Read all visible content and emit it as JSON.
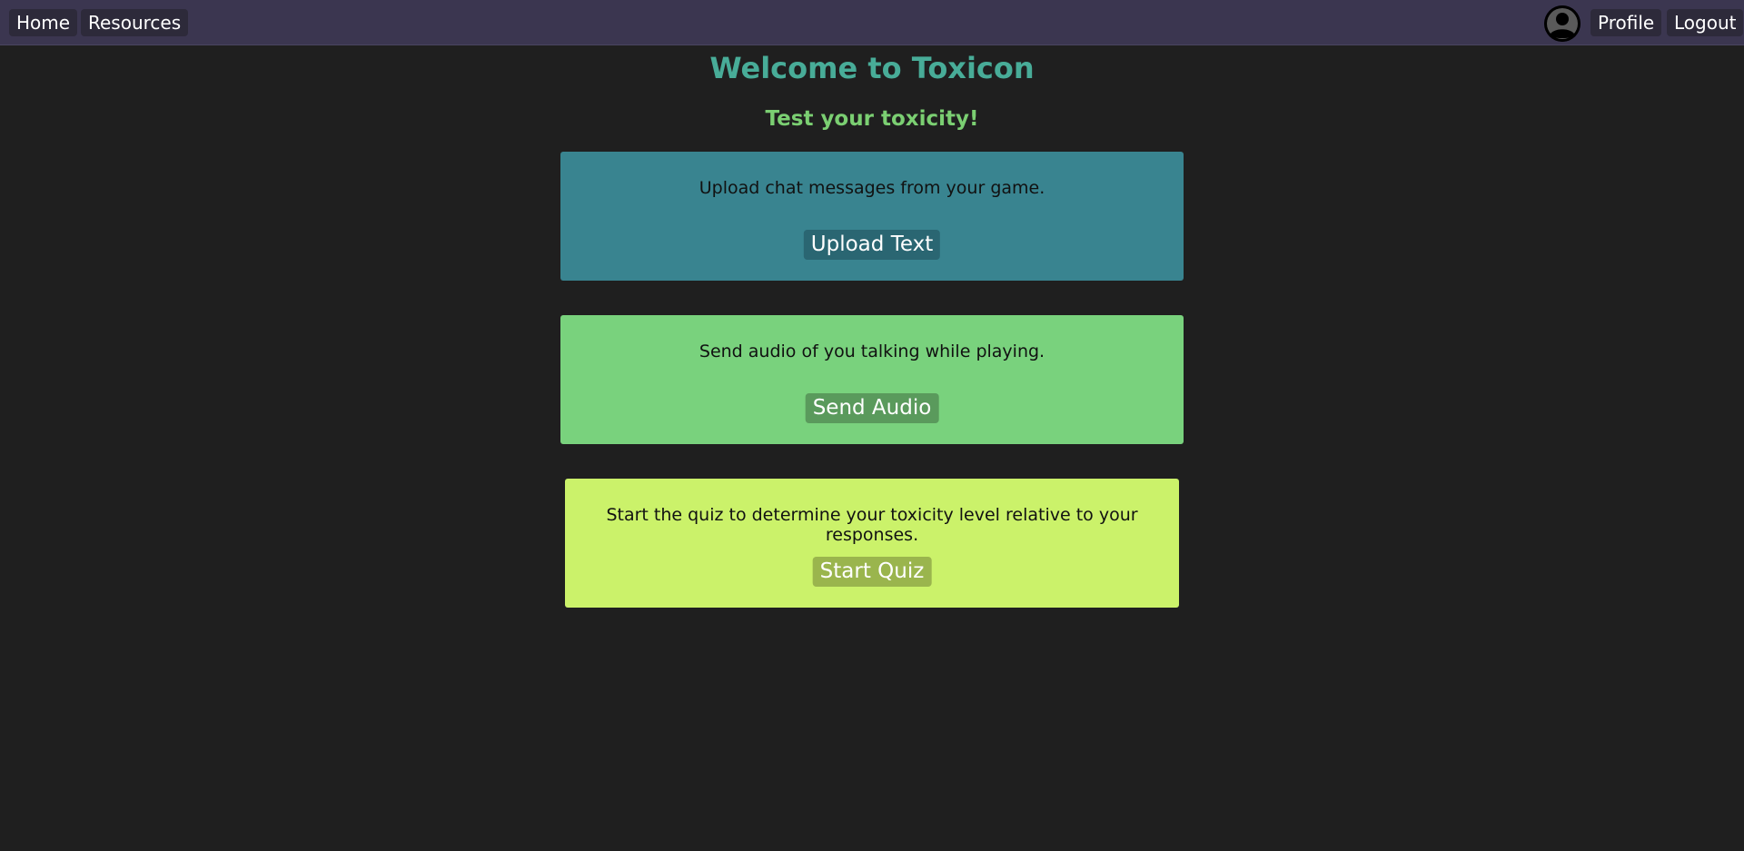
{
  "nav": {
    "home_label": "Home",
    "resources_label": "Resources",
    "profile_label": "Profile",
    "logout_label": "Logout",
    "avatar_icon": "user-avatar-icon"
  },
  "hero": {
    "title": "Welcome to Toxicon",
    "subtitle": "Test your toxicity!"
  },
  "cards": {
    "text": {
      "description": "Upload chat messages from your game.",
      "button_label": "Upload Text",
      "color": "#398490"
    },
    "audio": {
      "description": "Send audio of you talking while playing.",
      "button_label": "Send Audio",
      "color": "#79d27d"
    },
    "quiz": {
      "description": "Start the quiz to determine your toxicity level relative to your responses.",
      "button_label": "Start Quiz",
      "color": "#cbf26a"
    }
  },
  "colors": {
    "background": "#1f1f1f",
    "navbar": "#3b3650",
    "title": "#48ac98",
    "subtitle": "#7bcf72"
  }
}
